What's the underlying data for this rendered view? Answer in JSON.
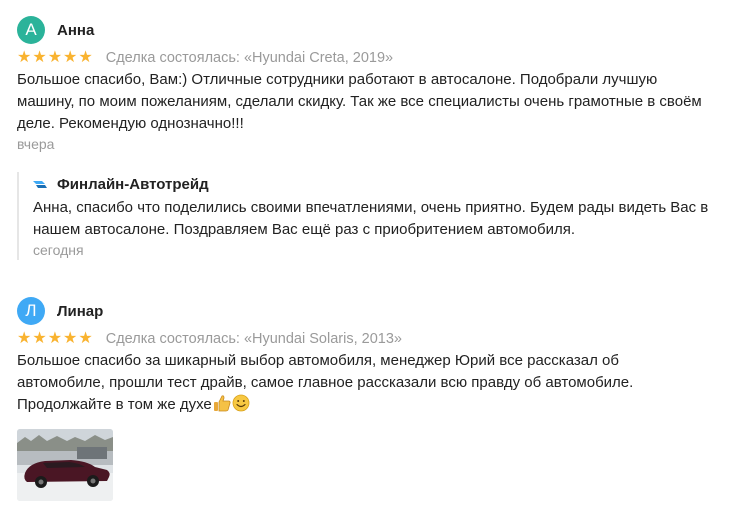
{
  "reviews": [
    {
      "avatar_letter": "А",
      "avatar_color": "#2bb39a",
      "author": "Анна",
      "stars": 5,
      "deal": "Сделка состоялась: «Hyundai Creta, 2019»",
      "text": "Большое спасибо, Вам:) Отличные сотрудники работают в автосалоне. Подобрали лучшую машину, по моим пожеланиям, сделали скидку. Так же все специалисты очень грамотные в своём деле. Рекомендую однозначно!!!",
      "date": "вчера",
      "reply": {
        "company": "Финлайн-Автотрейд",
        "text": "Анна, спасибо что поделились своими впечатлениями, очень приятно. Будем рады видеть Вас в нашем автосалоне. Поздравляем Вас ещё раз с приобритением автомобиля.",
        "date": "сегодня"
      }
    },
    {
      "avatar_letter": "Л",
      "avatar_color": "#3fa9f5",
      "author": "Линар",
      "stars": 5,
      "deal": "Сделка состоялась: «Hyundai Solaris, 2013»",
      "text": "Большое спасибо за шикарный выбор автомобиля, менеджер Юрий все рассказал об автомобиле, прошли тест драйв, самое главное рассказали всю правду об автомобиле. Продолжайте в том же духе",
      "emojis": [
        "thumbs-up-icon",
        "smiling-face-icon"
      ],
      "photo": "car-photo"
    }
  ],
  "colors": {
    "star": "#f9b330",
    "muted": "#9a9a9a",
    "reply_border": "#e6e6e6"
  }
}
